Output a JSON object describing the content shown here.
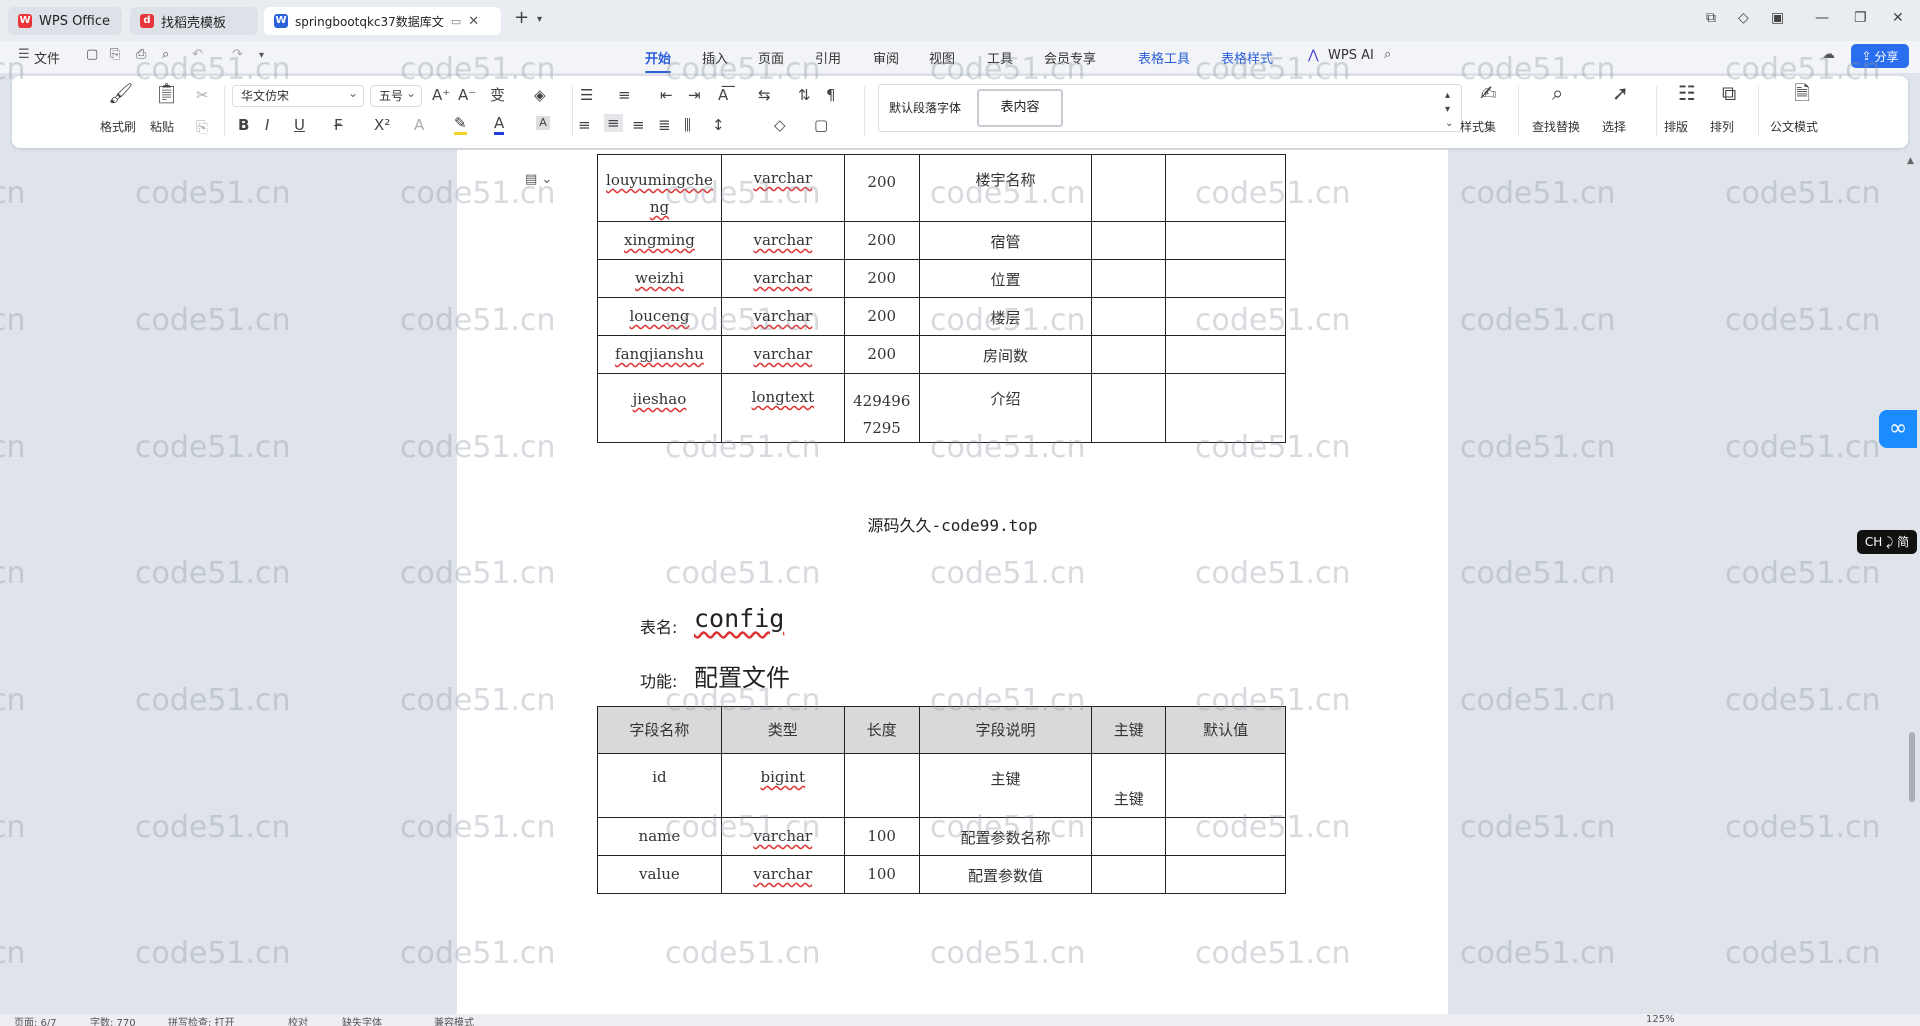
{
  "tabs": [
    {
      "label": "WPS Office",
      "icon": "wps-logo"
    },
    {
      "label": "找稻壳模板",
      "icon": "docer-icon"
    },
    {
      "label": "springbootqkc37数据库文",
      "icon": "word-doc-icon"
    }
  ],
  "menu": {
    "file": "文件",
    "items": [
      "开始",
      "插入",
      "页面",
      "引用",
      "审阅",
      "视图",
      "工具",
      "会员专享"
    ],
    "context_items": [
      "表格工具",
      "表格样式"
    ],
    "wps_ai": "WPS AI",
    "share": "分享"
  },
  "ribbon": {
    "format_painter": "格式刷",
    "paste": "粘贴",
    "font_name": "华文仿宋",
    "font_size": "五号",
    "para_style": "默认段落字体",
    "current_style": "表内容",
    "style_set": "样式集",
    "find_replace": "查找替换",
    "select": "选择",
    "layout": "排版",
    "arrange": "排列",
    "doc_mode": "公文模式"
  },
  "table1": {
    "rows": [
      {
        "field": "louyumingcheng",
        "type": "varchar",
        "length": "200",
        "desc": "楼宇名称",
        "pk": "",
        "default": ""
      },
      {
        "field": "xingming",
        "type": "varchar",
        "length": "200",
        "desc": "宿管",
        "pk": "",
        "default": ""
      },
      {
        "field": "weizhi",
        "type": "varchar",
        "length": "200",
        "desc": "位置",
        "pk": "",
        "default": ""
      },
      {
        "field": "louceng",
        "type": "varchar",
        "length": "200",
        "desc": "楼层",
        "pk": "",
        "default": ""
      },
      {
        "field": "fangjianshu",
        "type": "varchar",
        "length": "200",
        "desc": "房间数",
        "pk": "",
        "default": ""
      },
      {
        "field": "jieshao",
        "type": "longtext",
        "length": "4294967295",
        "desc": "介绍",
        "pk": "",
        "default": ""
      }
    ]
  },
  "caption": "源码久久-code99.top",
  "section": {
    "table_label": "表名:",
    "table_name": "config",
    "func_label": "功能:",
    "func_name": "配置文件"
  },
  "table2": {
    "headers": [
      "字段名称",
      "类型",
      "长度",
      "字段说明",
      "主键",
      "默认值"
    ],
    "rows": [
      {
        "field": "id",
        "type": "bigint",
        "length": "",
        "desc": "主键",
        "pk": "主键",
        "default": ""
      },
      {
        "field": "name",
        "type": "varchar",
        "length": "100",
        "desc": "配置参数名称",
        "pk": "",
        "default": ""
      },
      {
        "field": "value",
        "type": "varchar",
        "length": "100",
        "desc": "配置参数值",
        "pk": "",
        "default": ""
      }
    ]
  },
  "watermark": "code51.cn",
  "ime": "CH ⤸ 简",
  "status": {
    "page": "页面: 6/7",
    "words": "字数: 770",
    "spell": "拼写检查: 打开",
    "proof": "校对",
    "font_missing": "缺失字体",
    "mode": "兼容模式",
    "zoom": "125%"
  }
}
